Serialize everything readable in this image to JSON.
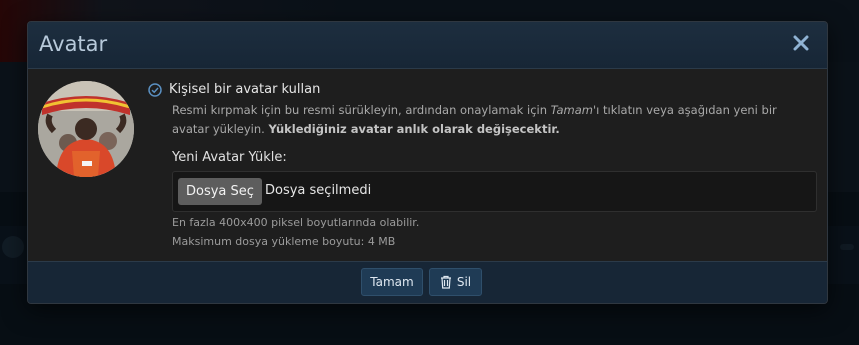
{
  "dialog": {
    "title": "Avatar",
    "close_label": "Close"
  },
  "avatar_option": {
    "label": "Kişisel bir avatar kullan",
    "help_part1": "Resmi kırpmak için bu resmi sürükleyin, ardından onaylamak için ",
    "help_em": "Tamam",
    "help_part2": "'ı tıklatın veya aşağıdan yeni bir avatar yükleyin. ",
    "help_bold": "Yüklediğiniz avatar anlık olarak değişecektir."
  },
  "upload": {
    "label": "Yeni Avatar Yükle:",
    "choose_button": "Dosya Seç",
    "file_status": "Dosya seçilmedi",
    "hint_size": "En fazla 400x400 piksel boyutlarında olabilir.",
    "hint_max": "Maksimum dosya yükleme boyutu: 4 MB"
  },
  "footer": {
    "ok_button": "Tamam",
    "delete_button": "Sil"
  },
  "icons": {
    "close": "close-icon",
    "check": "check-circle-icon",
    "delete": "trash-icon"
  },
  "colors": {
    "header_bg": "#1d2e3f",
    "body_bg": "#1e1e1e",
    "footer_bg": "#172636",
    "primary_button": "#1f3b55",
    "accent": "#5a8fc0"
  }
}
